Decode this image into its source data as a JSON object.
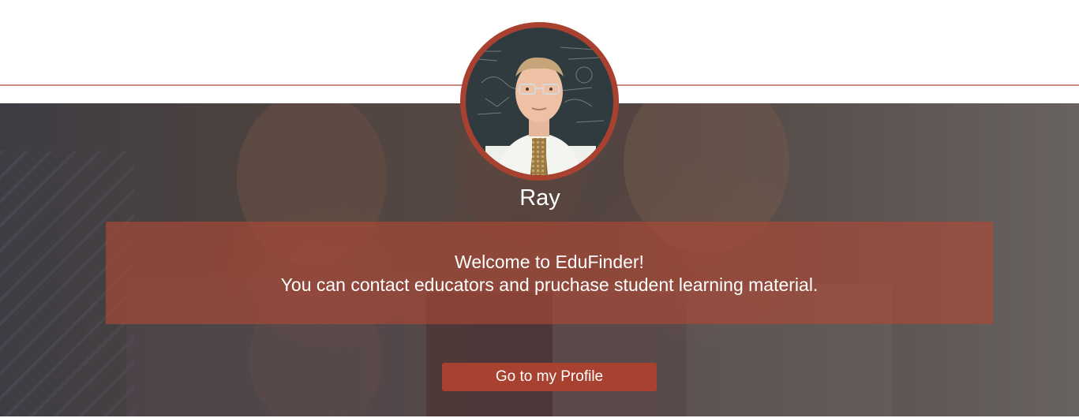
{
  "user": {
    "name": "Ray"
  },
  "welcome": {
    "title": "Welcome to EduFinder!",
    "subtitle": "You can contact educators and pruchase student learning material."
  },
  "actions": {
    "profile_button_label": "Go to my Profile"
  },
  "colors": {
    "accent": "#a8412f",
    "rule": "#c98c7f",
    "overlay": "#b24836"
  },
  "icons": {
    "avatar": "teacher-portrait-photo",
    "hero": "family-group-photo"
  }
}
